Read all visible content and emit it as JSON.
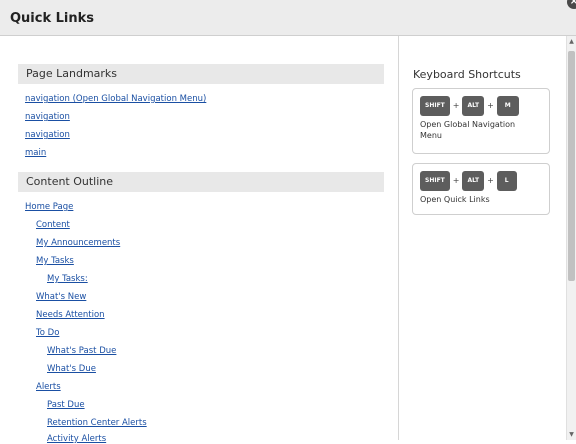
{
  "header": {
    "title": "Quick Links",
    "close_glyph": "×"
  },
  "landmarks": {
    "title": "Page Landmarks",
    "items": [
      "navigation (Open Global Navigation Menu)",
      "navigation",
      "navigation",
      "main"
    ]
  },
  "outline": {
    "title": "Content Outline",
    "items": [
      "Home Page",
      "Content",
      "My Announcements",
      "My Tasks",
      "My Tasks:",
      "What's New",
      "Needs Attention",
      "To Do",
      "What's Past Due",
      "What's Due",
      "Alerts",
      "Past Due",
      "Retention Center Alerts",
      "Activity Alerts"
    ]
  },
  "shortcuts": {
    "title": "Keyboard Shortcuts",
    "plus": "+",
    "items": [
      {
        "keys": [
          "SHIFT",
          "ALT",
          "M"
        ],
        "desc": "Open Global Navigation Menu"
      },
      {
        "keys": [
          "SHIFT",
          "ALT",
          "L"
        ],
        "desc": "Open Quick Links"
      }
    ]
  }
}
